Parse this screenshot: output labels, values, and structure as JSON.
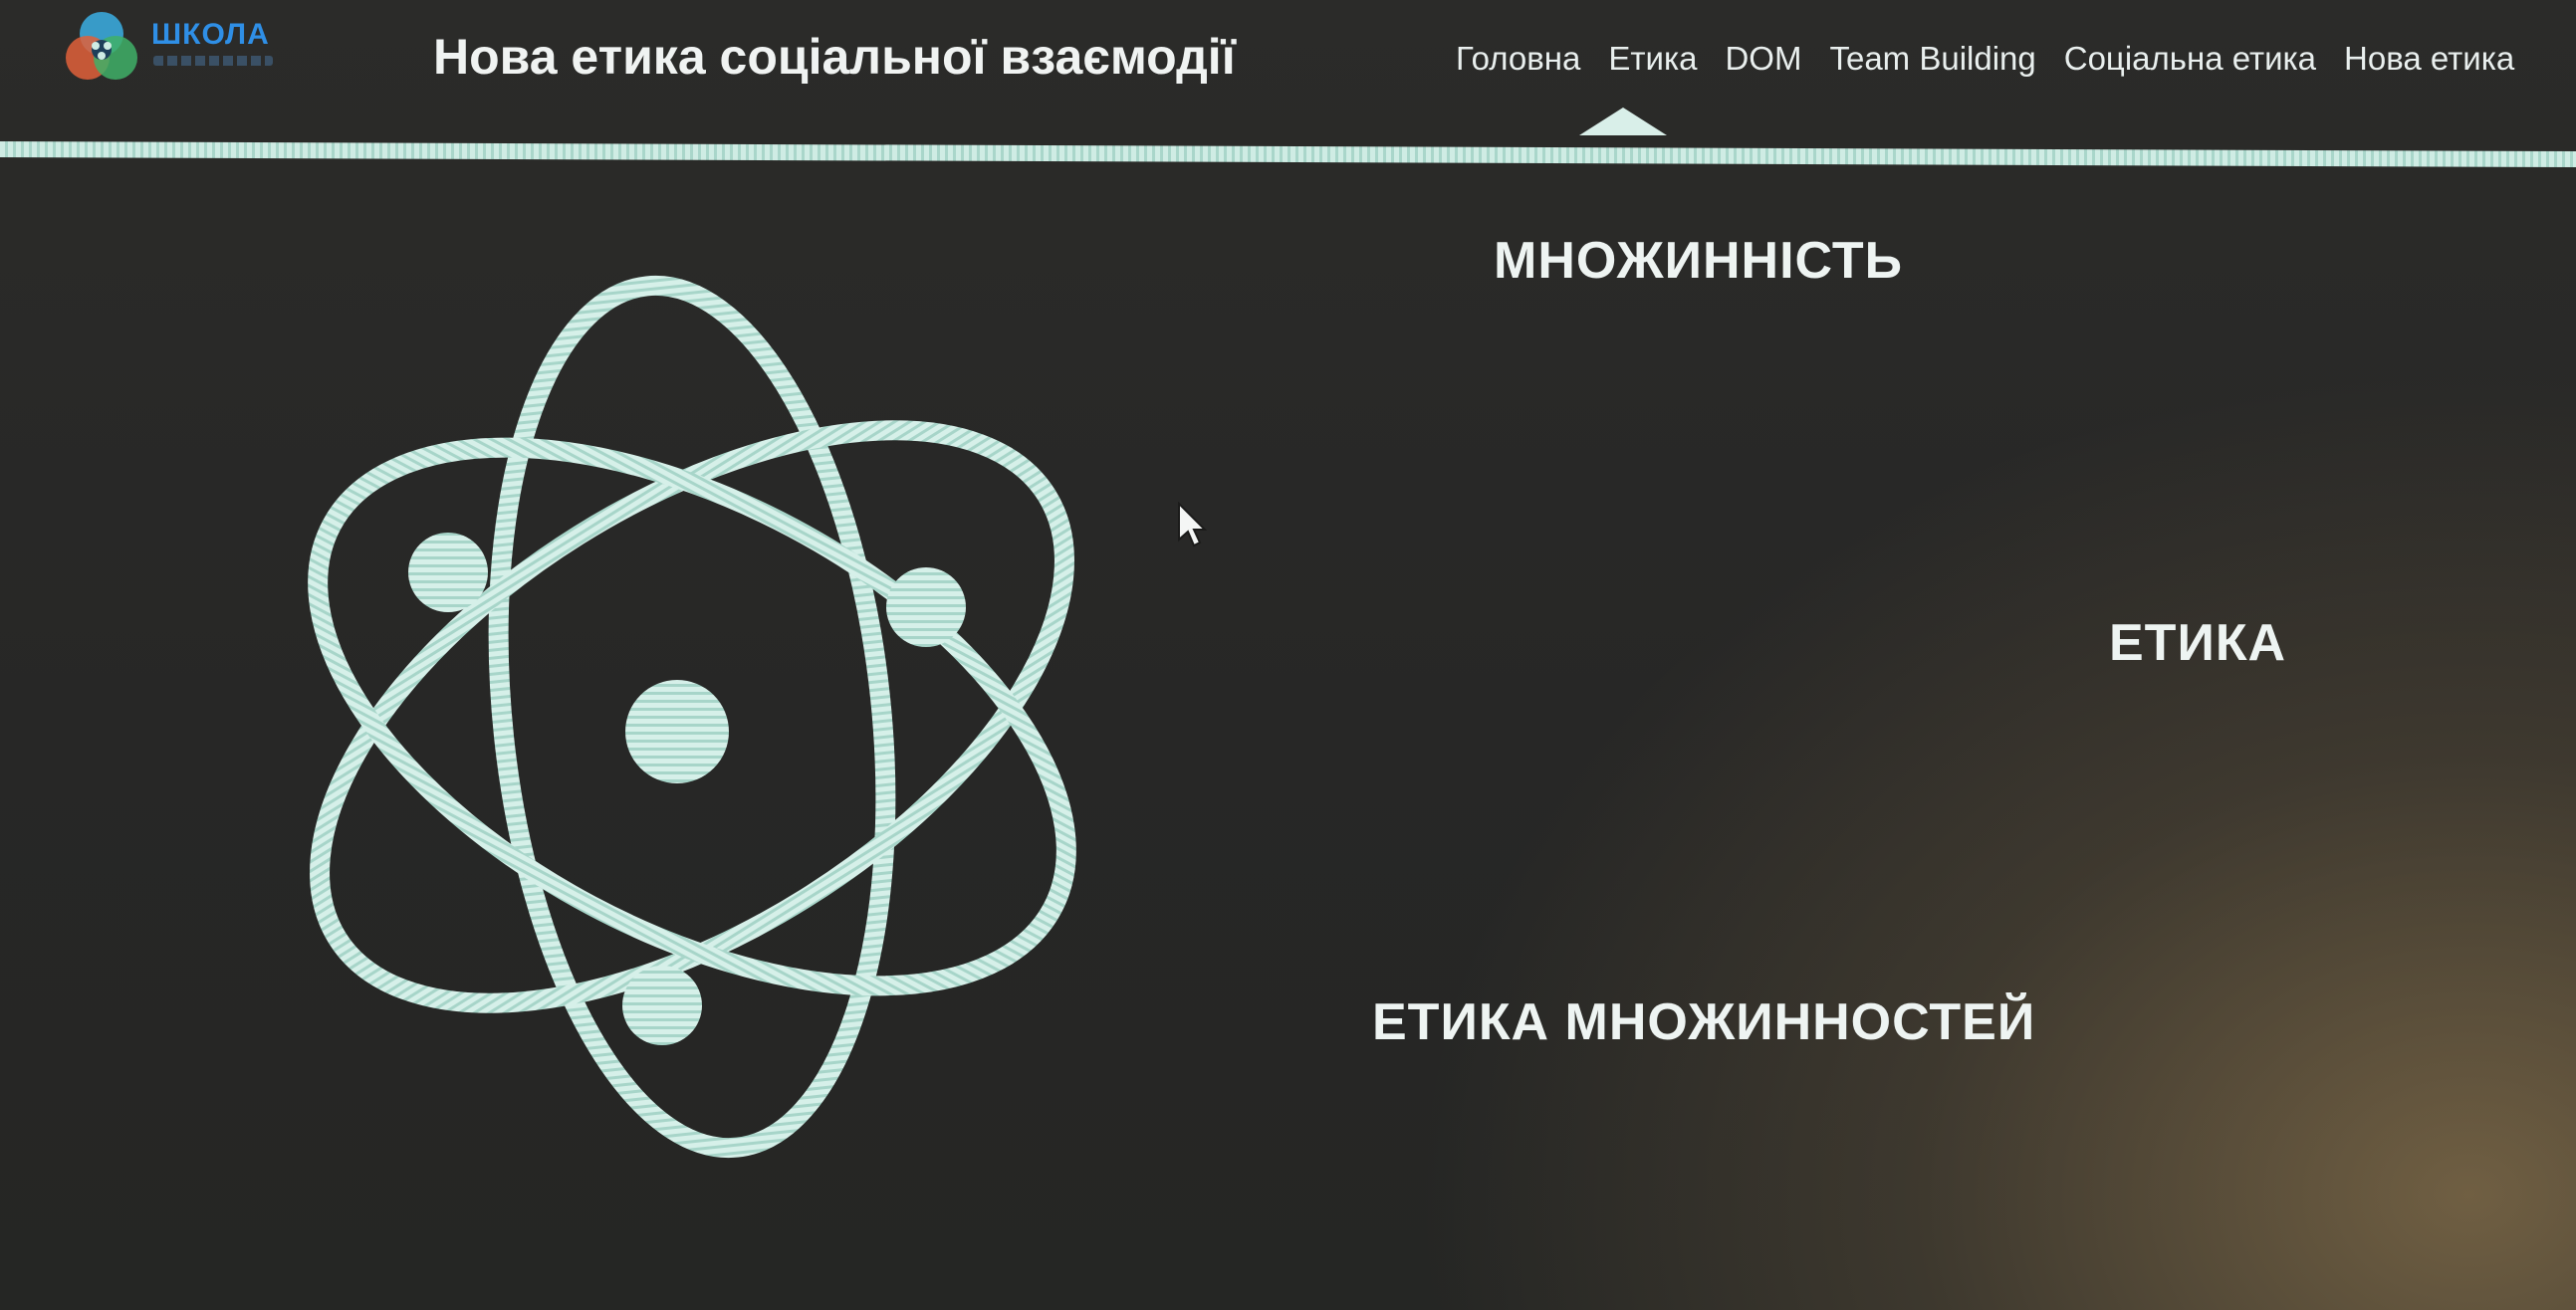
{
  "header": {
    "logo_text": "ШКОЛА",
    "site_title": "Нова етика соціальної взаємодії"
  },
  "nav": {
    "items": [
      {
        "label": "Головна"
      },
      {
        "label": "Етика"
      },
      {
        "label": "DOM"
      },
      {
        "label": "Team Building"
      },
      {
        "label": "Соціальна етика"
      },
      {
        "label": "Нова етика"
      }
    ],
    "active": "Етика"
  },
  "diagram": {
    "icon": "atom-icon",
    "stroke_color": "#cfece4"
  },
  "concepts": {
    "plurality": "МНОЖИННІСТЬ",
    "ethics": "ЕТИКА",
    "ethics_of_pluralities": "ЕТИКА МНОЖИННОСТЕЙ"
  },
  "colors": {
    "accent": "#cfece4",
    "logo_blue": "#2f8fe6",
    "background": "#2a2a27"
  }
}
